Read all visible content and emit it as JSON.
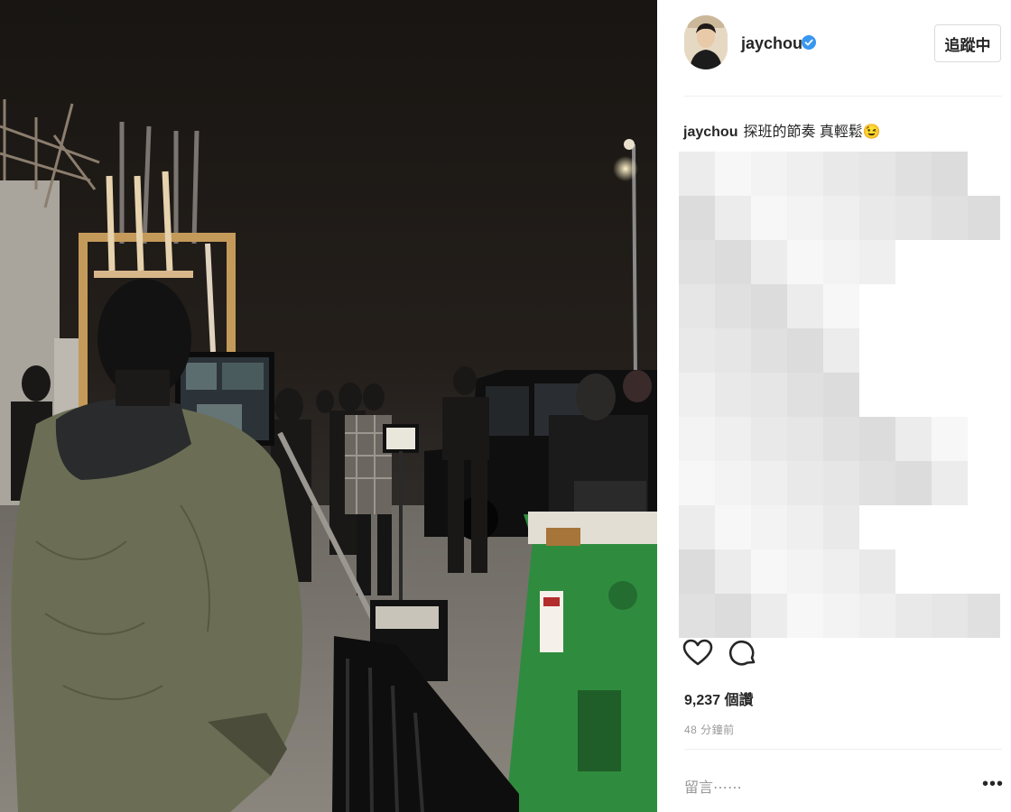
{
  "post": {
    "username": "jaychou",
    "follow_label": "追蹤中",
    "caption_user": "jaychou",
    "caption_text": "探班的節奏 真輕鬆😉",
    "likes": "9,237 個讚",
    "time_ago": "48 分鐘前",
    "comment_placeholder": "留言⋯⋯",
    "more_label": "•••"
  },
  "colors": {
    "verified_badge": "#3897f0",
    "text": "#262626",
    "muted": "#999999",
    "divider": "#efefef"
  },
  "icons": [
    "verified-badge-icon",
    "heart-icon",
    "comment-icon",
    "more-options-icon"
  ]
}
